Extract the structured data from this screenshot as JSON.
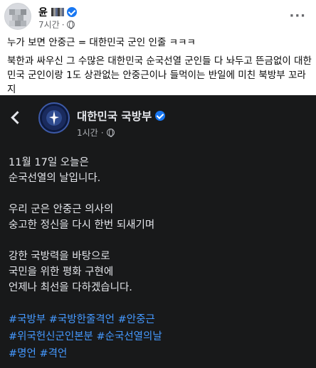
{
  "post": {
    "author_name": "윤",
    "time": "7시간",
    "more_label": "···",
    "line1": "누가 보면 안중근 = 대한민국 군인 인줄 ㅋㅋㅋ",
    "line2": "북한과 싸우신 그 수많은 대한민국 순국선열 군인들 다 놔두고 뜬금없이 대한민국 군인이랑 1도 상관없는 안중근이나 들먹이는 반일에 미친 북방부 꼬라지"
  },
  "embed": {
    "page_name": "대한민국 국방부",
    "time": "1시간",
    "paragraphs": [
      "11월 17일 오늘은\n순국선열의 날입니다.",
      "우리 군은 안중근 의사의\n숭고한 정신을  다시 한번 되새기며",
      "강한 국방력을 바탕으로\n국민을 위한 평화 구현에\n언제나 최선을 다하겠습니다."
    ],
    "hashtags": [
      "#국방부",
      "#국방한줄격언",
      "#안중근",
      "#위국헌신군인본분",
      "#순국선열의날",
      "#명언",
      "#격언"
    ]
  },
  "colors": {
    "accent": "#1877f2",
    "embed_bg": "#18191a",
    "hashtag": "#4599ff"
  },
  "icons": [
    "verified-icon",
    "globe-icon",
    "more-icon",
    "back-arrow-icon"
  ]
}
